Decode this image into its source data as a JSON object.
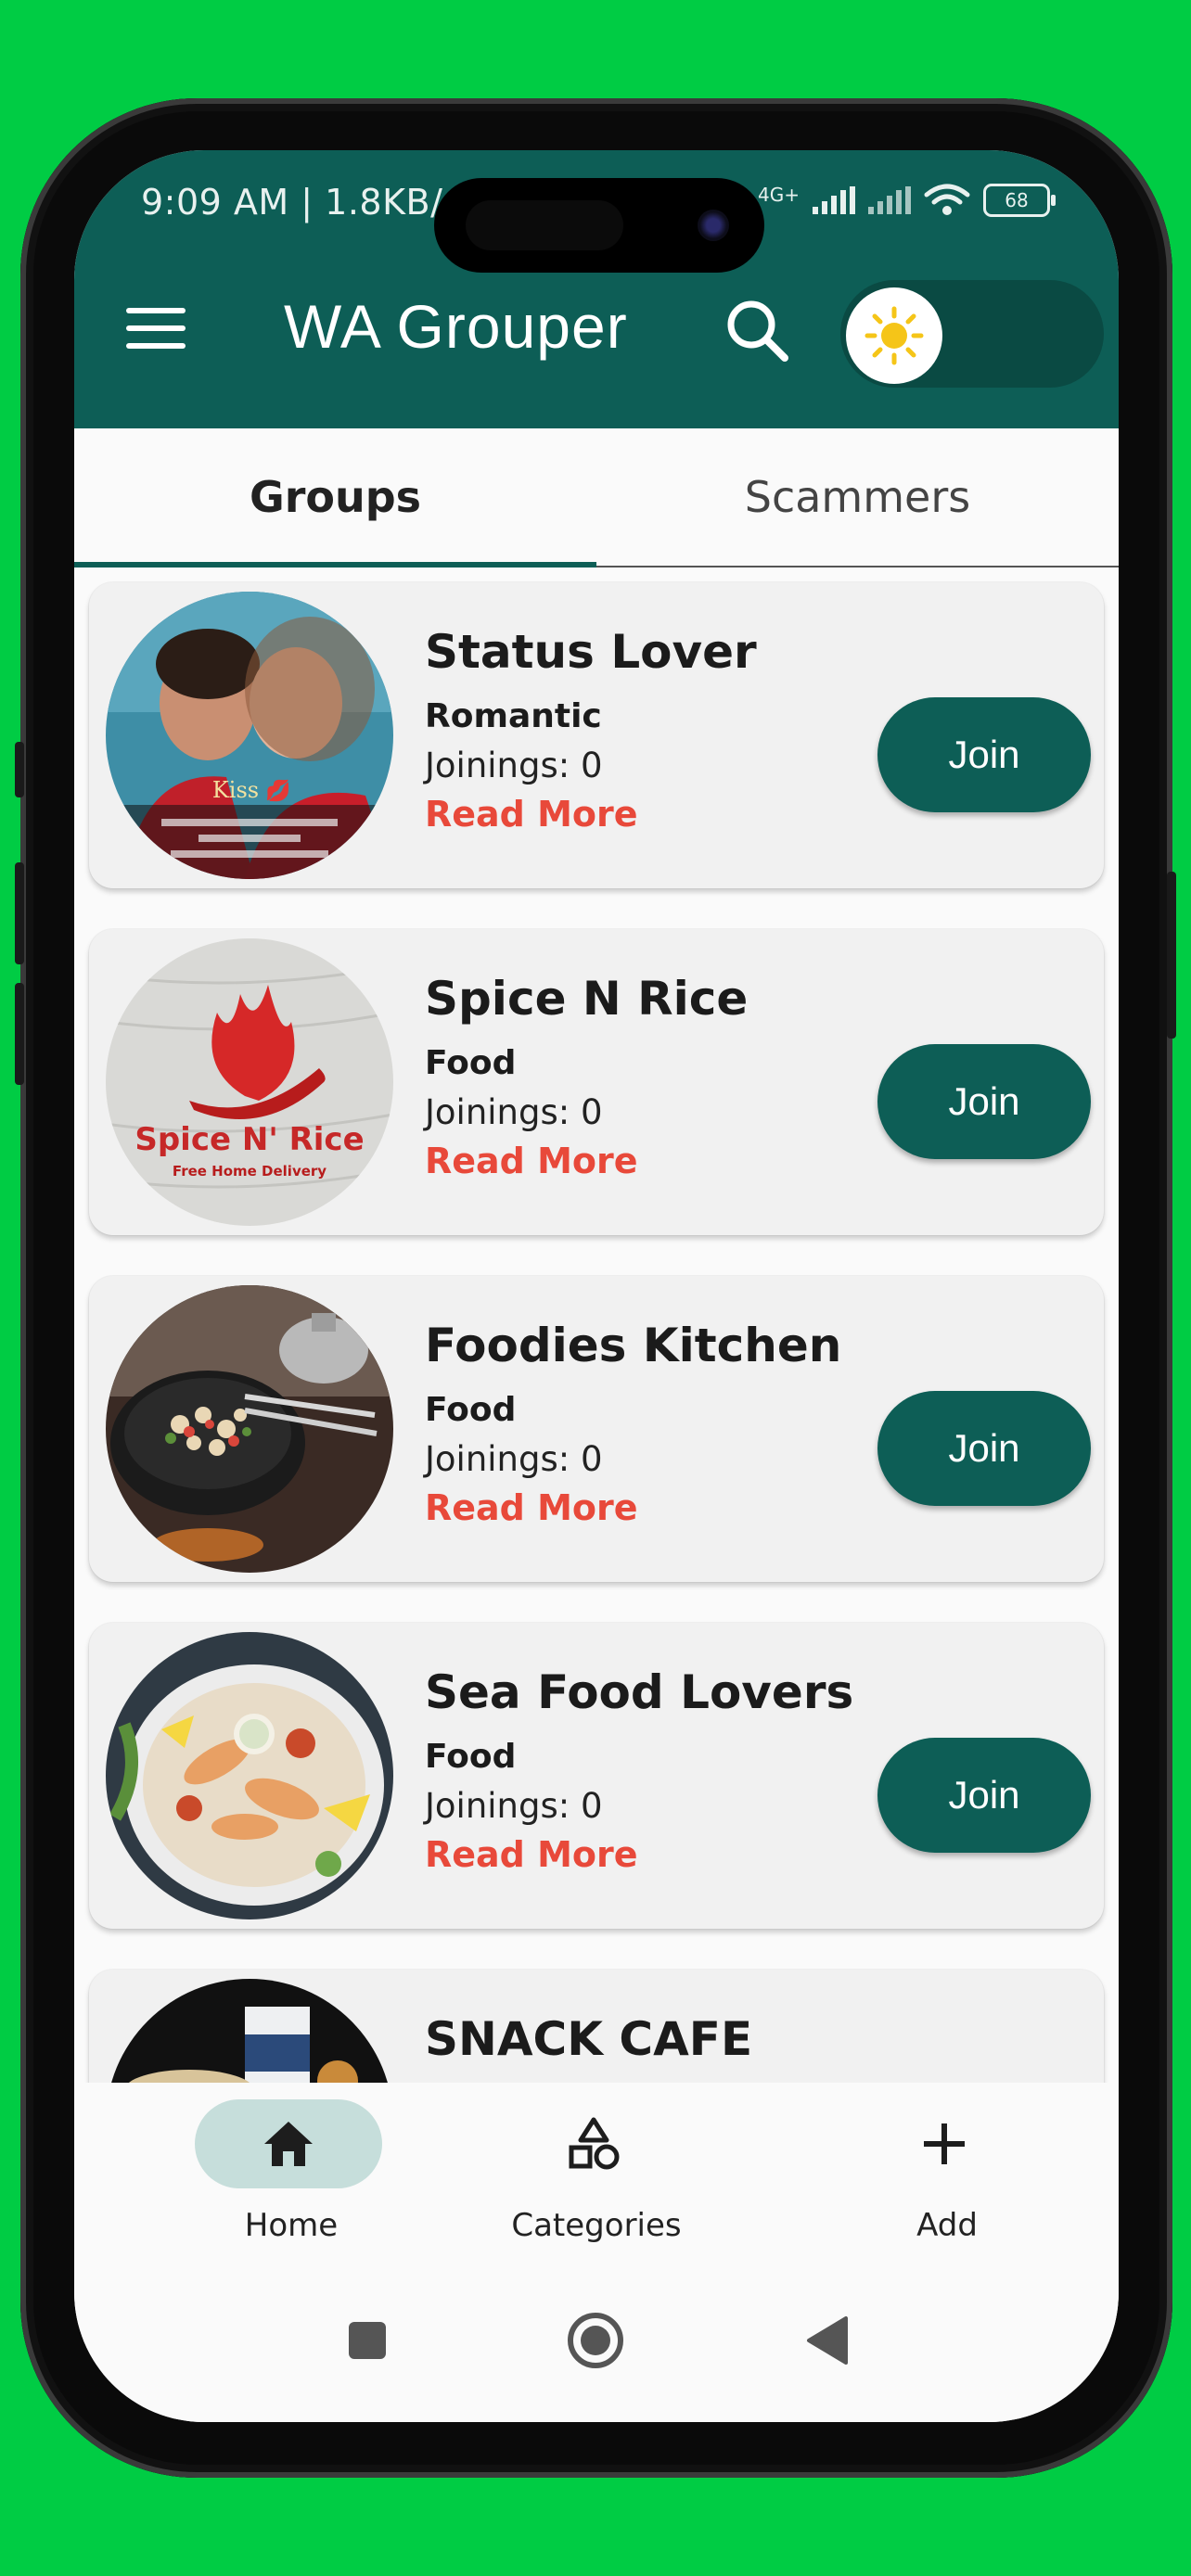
{
  "status_bar": {
    "time_text": "9:09 AM | 1.8KB/",
    "network_label": "4G+",
    "battery": "68"
  },
  "app_bar": {
    "title": "WA Grouper",
    "menu_icon": "hamburger-menu-icon",
    "search_icon": "search-icon",
    "theme_icon": "sun-icon",
    "colors": {
      "primary": "#0d5e56",
      "toggle_track": "#0a4a43",
      "sun": "#f5c518"
    }
  },
  "tabs": [
    {
      "label": "Groups",
      "active": true
    },
    {
      "label": "Scammers",
      "active": false
    }
  ],
  "groups": [
    {
      "name": "Status Lover",
      "category": "Romantic",
      "joinings": "Joinings: 0",
      "read_more": "Read More",
      "join_label": "Join",
      "image_caption": "Kiss"
    },
    {
      "name": "Spice N Rice",
      "category": "Food",
      "joinings": "Joinings: 0",
      "read_more": "Read More",
      "join_label": "Join",
      "image_title": "Spice N' Rice",
      "image_subtitle": "Free Home Delivery"
    },
    {
      "name": "Foodies Kitchen",
      "category": "Food",
      "joinings": "Joinings: 0",
      "read_more": "Read More",
      "join_label": "Join"
    },
    {
      "name": "Sea Food Lovers",
      "category": "Food",
      "joinings": "Joinings: 0",
      "read_more": "Read More",
      "join_label": "Join"
    },
    {
      "name": "SNACK CAFE"
    }
  ],
  "bottom_nav": [
    {
      "label": "Home",
      "icon": "home-icon",
      "active": true
    },
    {
      "label": "Categories",
      "icon": "shapes-icon",
      "active": false
    },
    {
      "label": "Add",
      "icon": "plus-icon",
      "active": false
    }
  ],
  "system_nav": [
    "recents-square-icon",
    "home-circle-icon",
    "back-triangle-icon"
  ],
  "colors": {
    "background": "#00cc44",
    "read_more": "#e8493a",
    "active_nav_pill": "#c6dedb"
  }
}
